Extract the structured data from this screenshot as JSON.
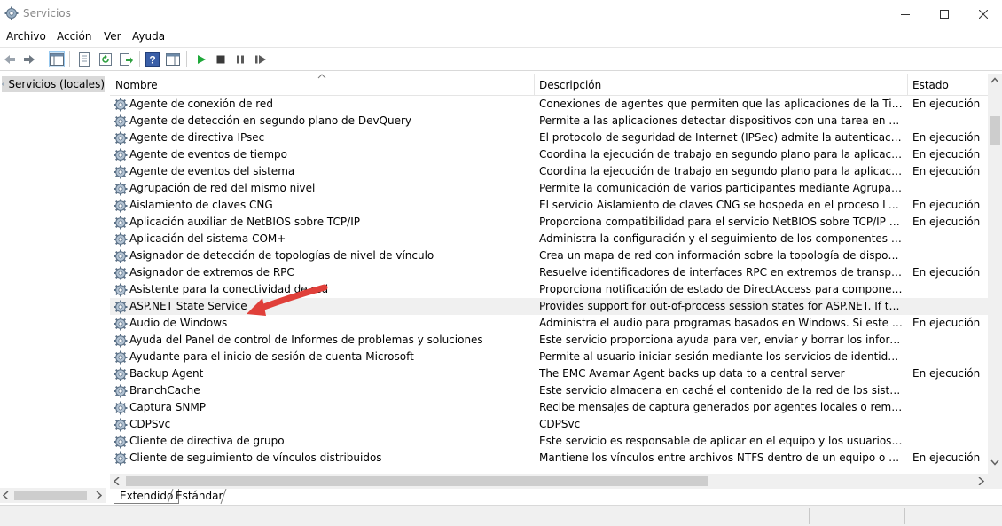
{
  "window": {
    "title": "Servicios",
    "controls": [
      "minimize-icon",
      "maximize-icon",
      "close-icon"
    ]
  },
  "menu": [
    "Archivo",
    "Acción",
    "Ver",
    "Ayuda"
  ],
  "toolbar": {
    "icons": [
      "back-arrow-icon",
      "forward-arrow-icon",
      "show-hide-tree-icon",
      "properties-icon",
      "refresh-icon",
      "export-list-icon",
      "help-icon",
      "show-action-pane-icon",
      "start-service-icon",
      "stop-service-icon",
      "pause-service-icon",
      "restart-service-icon"
    ],
    "play_color": "#1fa83a"
  },
  "tree": {
    "label": "Servicios (locales)"
  },
  "columns": {
    "name": "Nombre",
    "description": "Descripción",
    "state": "Estado"
  },
  "services": [
    {
      "name": "Agente de conexión de red",
      "description": "Conexiones de agentes que permiten que las aplicaciones de la Tienda Win...",
      "state": "En ejecución"
    },
    {
      "name": "Agente de detección en segundo plano de DevQuery",
      "description": "Permite a las aplicaciones detectar dispositivos con una tarea en segundo pl...",
      "state": ""
    },
    {
      "name": "Agente de directiva IPsec",
      "description": "El protocolo de seguridad de Internet (IPSec) admite la autenticación del mi...",
      "state": "En ejecución"
    },
    {
      "name": "Agente de eventos de tiempo",
      "description": "Coordina la ejecución de trabajo en segundo plano para la aplicación WinR...",
      "state": "En ejecución"
    },
    {
      "name": "Agente de eventos del sistema",
      "description": "Coordina la ejecución de trabajo en segundo plano para la aplicación WinR...",
      "state": "En ejecución"
    },
    {
      "name": "Agrupación de red del mismo nivel",
      "description": "Permite la comunicación de varios participantes mediante Agrupación de p...",
      "state": ""
    },
    {
      "name": "Aislamiento de claves CNG",
      "description": "El servicio Aislamiento de claves CNG se hospeda en el proceso LSA. Propor...",
      "state": "En ejecución"
    },
    {
      "name": "Aplicación auxiliar de NetBIOS sobre TCP/IP",
      "description": "Proporciona compatibilidad para el servicio NetBIOS sobre TCP/IP (NetBT) y...",
      "state": "En ejecución"
    },
    {
      "name": "Aplicación del sistema COM+",
      "description": "Administra la configuración y el seguimiento de los componentes del Mode...",
      "state": ""
    },
    {
      "name": "Asignador de detección de topologías de nivel de vínculo",
      "description": "Crea un mapa de red con información sobre la topología de dispositivos y d...",
      "state": ""
    },
    {
      "name": "Asignador de extremos de RPC",
      "description": "Resuelve identificadores de interfaces RPC en extremos de transporte. Si se ...",
      "state": "En ejecución"
    },
    {
      "name": "Asistente para la conectividad de red",
      "description": "Proporciona notificación de estado de DirectAccess para componentes de UI",
      "state": ""
    },
    {
      "name": "ASP.NET State Service",
      "description": "Provides support for out-of-process session states for ASP.NET. If this servic...",
      "state": ""
    },
    {
      "name": "Audio de Windows",
      "description": "Administra el audio para programas basados en Windows. Si este servicio se...",
      "state": "En ejecución"
    },
    {
      "name": "Ayuda del Panel de control de Informes de problemas y soluciones",
      "description": "Este servicio proporciona ayuda para ver, enviar y borrar los informes de pro...",
      "state": ""
    },
    {
      "name": "Ayudante para el inicio de sesión de cuenta Microsoft",
      "description": "Permite al usuario iniciar sesión mediante los servicios de identidad de cuen...",
      "state": ""
    },
    {
      "name": "Backup Agent",
      "description": "The EMC Avamar Agent backs up data to a central server",
      "state": "En ejecución"
    },
    {
      "name": "BranchCache",
      "description": "Este servicio almacena en caché el contenido de la red de los sistemas del m...",
      "state": ""
    },
    {
      "name": "Captura SNMP",
      "description": "Recibe mensajes de captura generados por agentes locales o remotos del Se...",
      "state": ""
    },
    {
      "name": "CDPSvc",
      "description": "CDPSvc",
      "state": ""
    },
    {
      "name": "Cliente de directiva de grupo",
      "description": "Este servicio es responsable de aplicar en el equipo y los usuarios la configur...",
      "state": ""
    },
    {
      "name": "Cliente de seguimiento de vínculos distribuidos",
      "description": "Mantiene los vínculos entre archivos NTFS dentro de un equipo o entre equi...",
      "state": "En ejecución"
    }
  ],
  "tabs": [
    "Extendido",
    "Estándar"
  ],
  "annotation": {
    "arrow_color": "#e0403a"
  }
}
